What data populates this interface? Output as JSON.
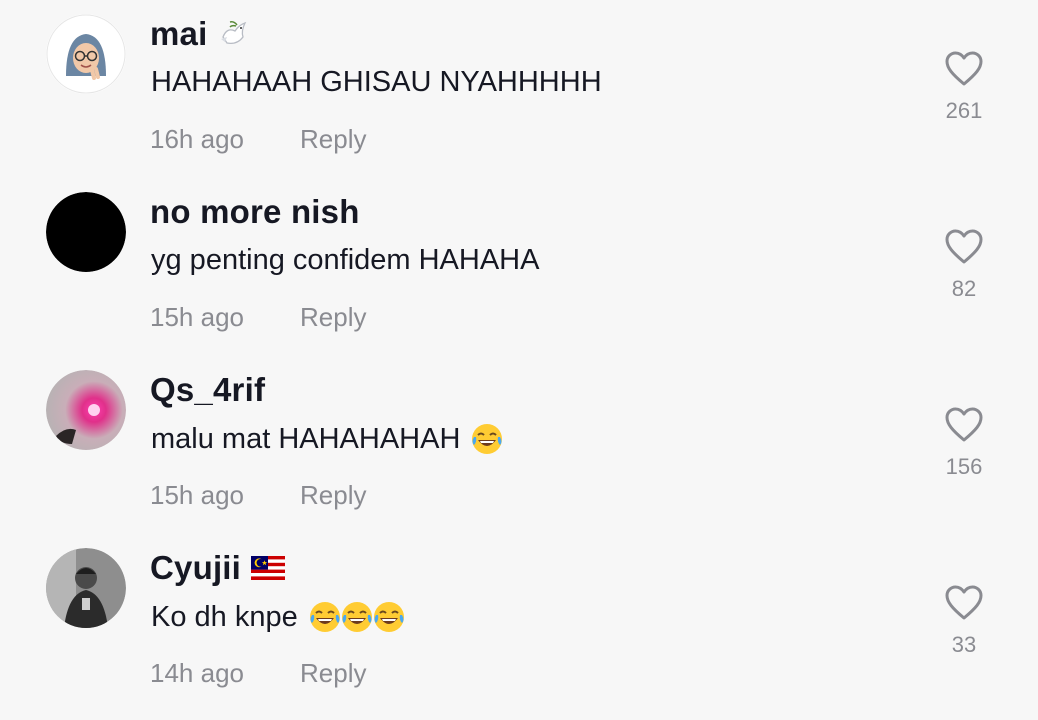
{
  "comments": [
    {
      "username": "mai",
      "name_icon": "dove-icon",
      "text": "HAHAHAAH GHISAU NYAHHHHH",
      "emoji": [],
      "time": "16h ago",
      "reply_label": "Reply",
      "likes": "261",
      "avatar": "avatar-hijab-memoji"
    },
    {
      "username": "no more nish",
      "name_icon": "",
      "text": "yg penting confidem HAHAHA",
      "emoji": [],
      "time": "15h ago",
      "reply_label": "Reply",
      "likes": "82",
      "avatar": "avatar-black"
    },
    {
      "username": "Qs_4rif",
      "name_icon": "",
      "text": "malu mat HAHAHAHAH",
      "emoji": [
        "tears-of-joy-emoji"
      ],
      "time": "15h ago",
      "reply_label": "Reply",
      "likes": "156",
      "avatar": "avatar-pink-glow"
    },
    {
      "username": "Cyujii",
      "name_icon": "malaysia-flag-icon",
      "text": "Ko dh knpe",
      "emoji": [
        "tears-of-joy-emoji",
        "tears-of-joy-emoji",
        "tears-of-joy-emoji"
      ],
      "time": "14h ago",
      "reply_label": "Reply",
      "likes": "33",
      "avatar": "avatar-dark-photo"
    }
  ],
  "colors": {
    "background": "#f7f7f7",
    "username": "#161823",
    "secondary": "#8a8b91"
  }
}
